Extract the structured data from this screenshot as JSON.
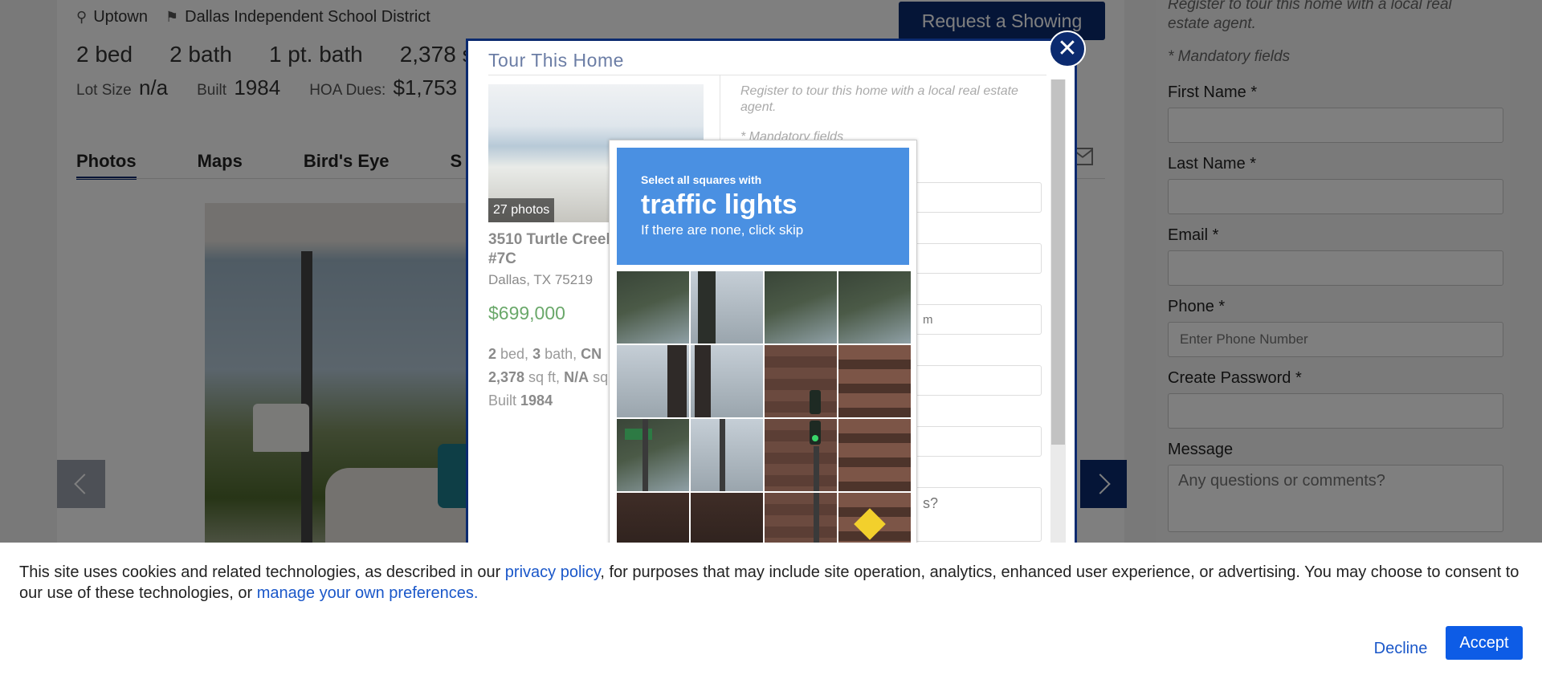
{
  "listing": {
    "neighborhood": "Uptown",
    "school_district": "Dallas Independent School District",
    "beds": "2 bed",
    "baths": "2 bath",
    "partial_baths": "1 pt. bath",
    "sqft": "2,378 sq ft",
    "lot_label": "Lot Size",
    "lot_value": "n/a",
    "built_label": "Built",
    "built_value": "1984",
    "hoa_label": "HOA Dues:",
    "hoa_value": "$1,753",
    "request_showing": "Request a Showing",
    "tabs": [
      "Photos",
      "Maps",
      "Bird's Eye",
      "S"
    ]
  },
  "sidebar": {
    "intro": "Register to tour this home with a local real estate agent.",
    "mandatory": "* Mandatory fields",
    "first_name_label": "First Name *",
    "last_name_label": "Last Name *",
    "email_label": "Email *",
    "phone_label": "Phone *",
    "phone_placeholder": "Enter Phone Number",
    "password_label": "Create Password *",
    "message_label": "Message",
    "message_placeholder": "Any questions or comments?"
  },
  "modal": {
    "title": "Tour This Home",
    "photos_badge": "27 photos",
    "address": "3510 Turtle Creek Boulevard #7C",
    "city": "Dallas, TX 75219",
    "price": "$699,000",
    "beds": "2",
    "baths": "3",
    "type": "CN",
    "sqft": "2,378",
    "lot": "N/A",
    "built": "1984",
    "register_text": "Register to tour this home with a local real estate agent.",
    "mandatory": "* Mandatory fields",
    "email_placeholder_partial": "m",
    "message_placeholder_partial": "s?"
  },
  "captcha": {
    "line1": "Select all squares with",
    "target": "traffic lights",
    "line3": "If there are none, click skip"
  },
  "cookie": {
    "text_before": "This site uses cookies and related technologies, as described in our ",
    "privacy_link": "privacy policy",
    "text_middle": ", for purposes that may include site operation, analytics, enhanced user experience, or advertising. You may choose to consent to our use of these technologies, or ",
    "manage_link": "manage your own preferences.",
    "decline": "Decline",
    "accept": "Accept"
  },
  "icons": {
    "location": "map-pin-icon",
    "school": "school-icon",
    "close": "close-icon",
    "mail": "mail-icon",
    "prev": "chevron-left-icon",
    "next": "chevron-right-icon"
  },
  "colors": {
    "brand_navy": "#0b2a6f",
    "captcha_blue": "#4a90e2",
    "price_green": "#6aa86a",
    "accept_blue": "#0d5ce6"
  }
}
